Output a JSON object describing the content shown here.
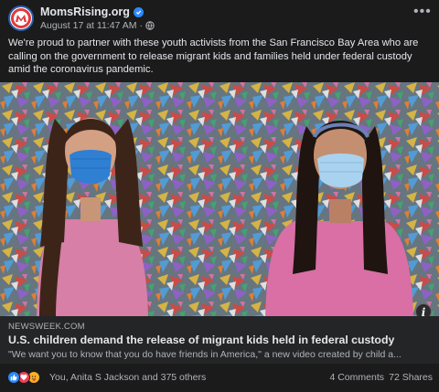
{
  "post": {
    "page_name": "MomsRising.org",
    "verified": true,
    "timestamp": "August 17 at 11:47 AM",
    "separator": "·",
    "privacy_icon": "globe-icon",
    "caption": "We're proud to partner with these youth activists from the San Francisco Bay Area who are calling on the government to release migrant kids and families held under federal custody amid the coronavirus pandemic."
  },
  "link_preview": {
    "domain": "NEWSWEEK.COM",
    "title": "U.S. children demand the release of migrant kids held in federal custody",
    "description": "\"We want you to know that you do have friends in America,\" a new video created by child a..."
  },
  "reactions": {
    "icons": [
      "like-icon",
      "love-icon",
      "care-icon"
    ],
    "names": "You, Anita S Jackson and 375 others",
    "comments": "4 Comments",
    "shares": "72 Shares"
  },
  "colors": {
    "background": "#1b1b1c",
    "link_box": "#242526",
    "text_primary": "#e4e6eb",
    "text_secondary": "#b0b3b8",
    "verified_blue": "#2d88ff"
  }
}
